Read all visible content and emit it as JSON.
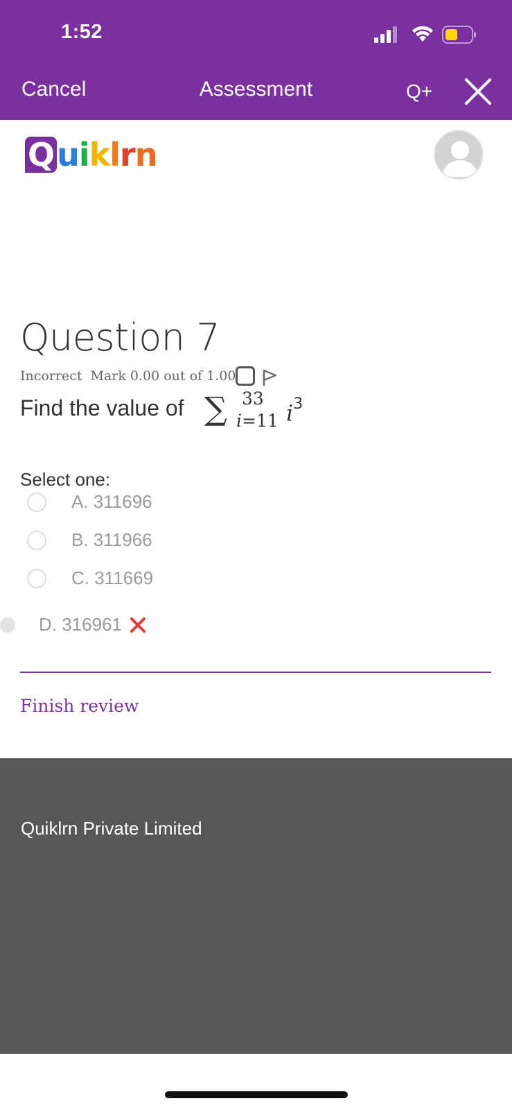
{
  "status_bar": {
    "time": "1:52"
  },
  "nav": {
    "cancel": "Cancel",
    "title": "Assessment",
    "q_plus": "Q+"
  },
  "logo": {
    "q": "Q",
    "u": "u",
    "i": "i",
    "k": "k",
    "l": "l",
    "r": "r",
    "n": "n"
  },
  "question": {
    "title": "Question 7",
    "state": "Incorrect",
    "mark": "Mark 0.00 out of 1.00",
    "text_prefix": "Find the value of",
    "math": {
      "sigma": "∑",
      "upper": "33",
      "lower_var": "i",
      "lower_eq": "=11",
      "term": "i",
      "exponent": "3"
    },
    "select_label": "Select one:",
    "options": [
      {
        "label": "A. 311696",
        "selected": false
      },
      {
        "label": "B. 311966",
        "selected": false
      },
      {
        "label": "C. 311669",
        "selected": false
      },
      {
        "label": "D. 316961",
        "selected": true,
        "incorrect": true
      }
    ]
  },
  "finish_review": "Finish review",
  "footer": {
    "company": "Quiklrn Private Limited"
  },
  "colors": {
    "brand_purple": "#7a309e",
    "footer_gray": "#575757",
    "incorrect_red": "#e53935",
    "battery_yellow": "#ffd60a"
  }
}
